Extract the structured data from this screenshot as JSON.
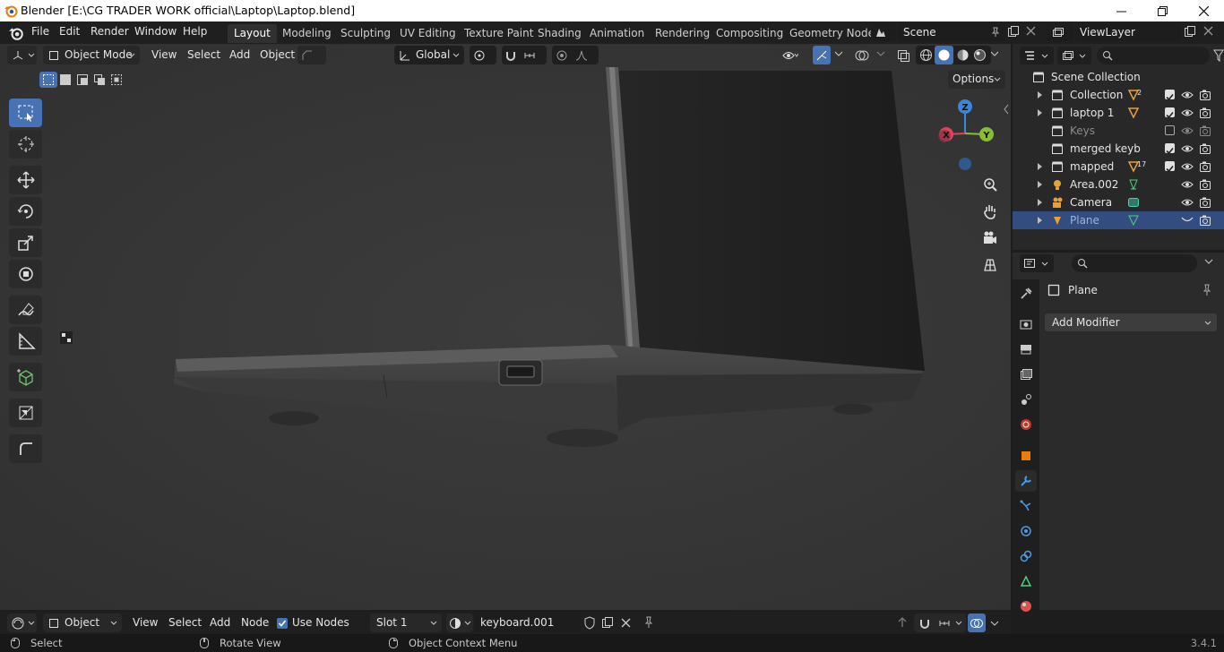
{
  "window": {
    "title": "Blender [E:\\CG TRADER WORK official\\Laptop\\Laptop.blend]",
    "buttons": [
      "minimize",
      "maximize",
      "close"
    ]
  },
  "menubar": {
    "items": [
      "File",
      "Edit",
      "Render",
      "Window",
      "Help"
    ]
  },
  "workspaces": {
    "tabs": [
      "Layout",
      "Modeling",
      "Sculpting",
      "UV Editing",
      "Texture Paint",
      "Shading",
      "Animation",
      "Rendering",
      "Compositing",
      "Geometry Node"
    ],
    "active": "Layout"
  },
  "scene": {
    "name": "Scene",
    "view_layer": "ViewLayer"
  },
  "viewport_header": {
    "mode": "Object Mode",
    "menus": [
      "View",
      "Select",
      "Add",
      "Object"
    ],
    "orientation": "Global",
    "options_label": "Options"
  },
  "gizmo": {
    "x": "X",
    "y": "Y",
    "z": "Z"
  },
  "outliner": {
    "root": "Scene Collection",
    "rows": [
      {
        "name": "Collection",
        "badge": "2",
        "type": "collection",
        "checked": true
      },
      {
        "name": "laptop 1",
        "badge": "",
        "type": "collection",
        "checked": true
      },
      {
        "name": "Keys",
        "badge": "",
        "type": "collection",
        "checked": false,
        "dim": true
      },
      {
        "name": "merged keyb",
        "badge": "",
        "type": "collection",
        "checked": true
      },
      {
        "name": "mapped",
        "badge": "17",
        "type": "collection",
        "checked": true
      },
      {
        "name": "Area.002",
        "badge": "",
        "type": "light"
      },
      {
        "name": "Camera",
        "badge": "",
        "type": "camera"
      },
      {
        "name": "Plane",
        "badge": "",
        "type": "mesh",
        "selected": true
      }
    ]
  },
  "properties": {
    "object_name": "Plane",
    "add_modifier": "Add Modifier"
  },
  "node_header": {
    "editor_type": "Object",
    "menus": [
      "View",
      "Select",
      "Add",
      "Node"
    ],
    "use_nodes_label": "Use Nodes",
    "use_nodes_checked": true,
    "slot": "Slot 1",
    "material": "keyboard.001"
  },
  "statusbar": {
    "select": "Select",
    "rotate": "Rotate View",
    "context": "Object Context Menu",
    "version": "3.4.1"
  },
  "colors": {
    "accent": "#4772b3",
    "selection": "#334d80",
    "axis_x": "#e0445a",
    "axis_y": "#8bbd34",
    "axis_z": "#3a86d8"
  }
}
